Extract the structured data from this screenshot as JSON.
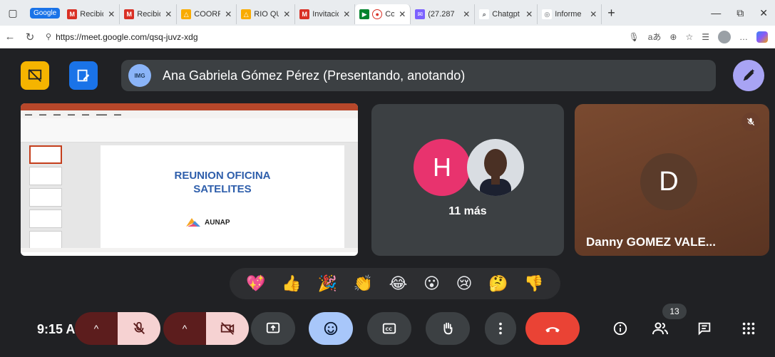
{
  "browser": {
    "tabs": [
      {
        "label": "Recibido",
        "favicon": "gmail-icon",
        "color": "#d93025"
      },
      {
        "label": "Recibido",
        "favicon": "gmail-icon",
        "color": "#d93025"
      },
      {
        "label": "COORPI",
        "favicon": "drive-icon",
        "color": "#f9ab00"
      },
      {
        "label": "RIO QUI",
        "favicon": "drive-icon",
        "color": "#f9ab00"
      },
      {
        "label": "Invitació",
        "favicon": "gmail-icon",
        "color": "#d93025"
      },
      {
        "label": "Cor",
        "favicon": "meet-icon",
        "color": "#00832d"
      },
      {
        "label": "(27.287",
        "favicon": "mail-icon",
        "color": "#7b61ff"
      },
      {
        "label": "Chatgpt",
        "favicon": "search-icon",
        "color": "#5f6368"
      },
      {
        "label": "Informe",
        "favicon": "web-icon",
        "color": "#5f6368"
      }
    ],
    "google_label": "Google",
    "url": "https://meet.google.com/qsq-juvz-xdg"
  },
  "meet": {
    "presenter_name": "Ana Gabriela Gómez Pérez (Presentando, anotando)",
    "presenter_avatar_text": "IMG",
    "slide": {
      "title_line1": "REUNION OFICINA",
      "title_line2": "SATELITES",
      "logo_text": "AUNAP"
    },
    "more_tile": {
      "initial": "H",
      "more_label": "11 más"
    },
    "danny_tile": {
      "initial": "D",
      "name": "Danny GOMEZ VALE..."
    },
    "reactions": [
      "💖",
      "👍",
      "🎉",
      "👏",
      "😂",
      "😮",
      "😢",
      "🤔",
      "👎"
    ],
    "clock": "9:15 A",
    "participant_count": "13",
    "colors": {
      "end_call": "#ea4335",
      "mic_off_bg": "#f6d2d2",
      "caret_bg": "#5c1d1d",
      "emoji_active": "#a8c7fa",
      "presenter_bar": "#3c4043",
      "h_avatar": "#e8336e"
    }
  }
}
